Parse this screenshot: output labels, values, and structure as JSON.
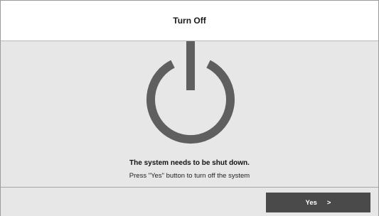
{
  "header": {
    "title": "Turn Off"
  },
  "main": {
    "icon": "power-icon",
    "message_primary": "The system needs to be shut down.",
    "message_secondary": "Press \"Yes\" button to turn off the system"
  },
  "footer": {
    "yes_label": "Yes",
    "yes_chevron": ">"
  },
  "colors": {
    "header_bg": "#ffffff",
    "body_bg": "#e7e7e7",
    "icon_color": "#5f5f5f",
    "button_bg": "#4a4a4a",
    "button_text": "#ffffff"
  }
}
